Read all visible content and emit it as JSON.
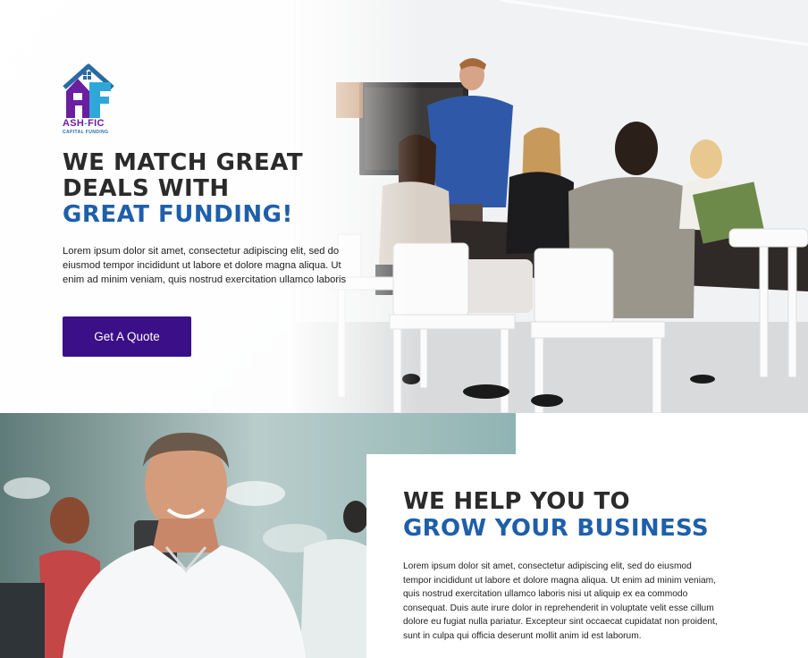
{
  "brand": {
    "name_part1": "ASH",
    "name_sep": "-",
    "name_part2": "FIC",
    "tagline": "CAPITAL FUNDING"
  },
  "hero": {
    "title_line1": "WE MATCH GREAT",
    "title_line2": "DEALS WITH",
    "title_accent": "GREAT FUNDING!",
    "body": "Lorem ipsum dolor sit amet, consectetur adipiscing elit, sed do eiusmod tempor incididunt ut labore et dolore magna aliqua. Ut enim ad minim veniam, quis nostrud exercitation ullamco laboris",
    "cta_label": "Get A Quote"
  },
  "grow": {
    "title_line1": "WE HELP YOU TO",
    "title_accent": "GROW YOUR BUSINESS",
    "body": "Lorem ipsum dolor sit amet, consectetur adipiscing elit, sed do eiusmod tempor incididunt ut labore et dolore magna aliqua. Ut enim ad minim veniam, quis nostrud exercitation ullamco laboris nisi ut aliquip ex ea commodo consequat. Duis aute irure dolor in reprehenderit in voluptate velit esse cillum dolore eu fugiat nulla pariatur. Excepteur sint occaecat cupidatat non proident, sunt in culpa qui officia deserunt mollit anim id est laborum."
  },
  "colors": {
    "accent_blue": "#1f5faa",
    "button_purple": "#3a0f87",
    "logo_purple": "#6a1fa0",
    "logo_cyan": "#2fa7d9",
    "heading_dark": "#2b2b2b"
  }
}
